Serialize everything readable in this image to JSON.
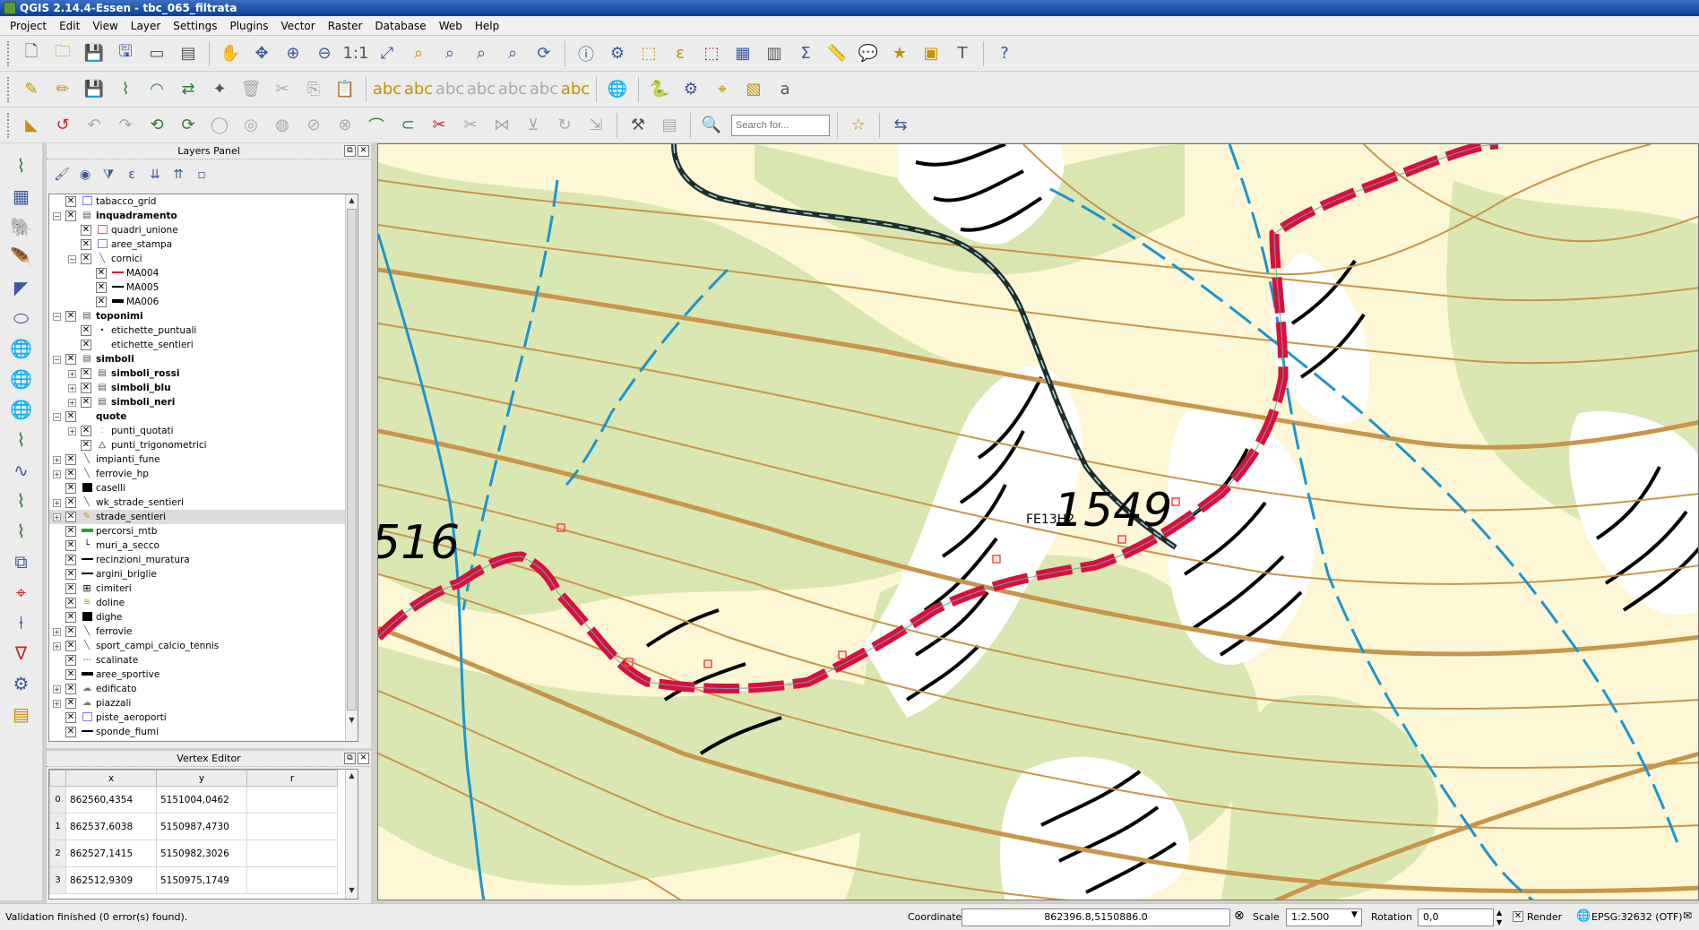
{
  "window": {
    "title": "QGIS 2.14.4-Essen - tbc_065_filtrata"
  },
  "menu": [
    "Project",
    "Edit",
    "View",
    "Layer",
    "Settings",
    "Plugins",
    "Vector",
    "Raster",
    "Database",
    "Web",
    "Help"
  ],
  "toolbar": {
    "search_placeholder": "Search for..."
  },
  "layers_panel": {
    "title": "Layers Panel",
    "layers": [
      {
        "name": "tabacco_grid",
        "depth": 0,
        "expander": "",
        "bold": false,
        "symbol": "square",
        "checked": true
      },
      {
        "name": "inquadramento",
        "depth": 0,
        "expander": "-",
        "bold": true,
        "symbol": "group",
        "checked": true
      },
      {
        "name": "quadri_unione",
        "depth": 1,
        "expander": "",
        "bold": false,
        "symbol": "square-pink",
        "checked": true
      },
      {
        "name": "aree_stampa",
        "depth": 1,
        "expander": "",
        "bold": false,
        "symbol": "square",
        "checked": true
      },
      {
        "name": "cornici",
        "depth": 1,
        "expander": "-",
        "bold": false,
        "symbol": "line-style",
        "checked": true
      },
      {
        "name": "MA004",
        "depth": 2,
        "expander": "",
        "bold": false,
        "symbol": "line-red",
        "checked": true
      },
      {
        "name": "MA005",
        "depth": 2,
        "expander": "",
        "bold": false,
        "symbol": "line-black",
        "checked": true
      },
      {
        "name": "MA006",
        "depth": 2,
        "expander": "",
        "bold": false,
        "symbol": "line-black-thick",
        "checked": true
      },
      {
        "name": "toponimi",
        "depth": 0,
        "expander": "-",
        "bold": true,
        "symbol": "group",
        "checked": true
      },
      {
        "name": "etichette_puntuali",
        "depth": 1,
        "expander": "",
        "bold": false,
        "symbol": "dot",
        "checked": true
      },
      {
        "name": "etichette_sentieri",
        "depth": 1,
        "expander": "",
        "bold": false,
        "symbol": "none",
        "checked": true
      },
      {
        "name": "simboli",
        "depth": 0,
        "expander": "-",
        "bold": true,
        "symbol": "group",
        "checked": true
      },
      {
        "name": "simboli_rossi",
        "depth": 1,
        "expander": "+",
        "bold": true,
        "symbol": "group",
        "checked": true
      },
      {
        "name": "simboli_blu",
        "depth": 1,
        "expander": "+",
        "bold": true,
        "symbol": "group",
        "checked": true
      },
      {
        "name": "simboli_neri",
        "depth": 1,
        "expander": "+",
        "bold": true,
        "symbol": "group",
        "checked": true
      },
      {
        "name": "quote",
        "depth": 0,
        "expander": "-",
        "bold": true,
        "symbol": "none",
        "checked": true
      },
      {
        "name": "punti_quotati",
        "depth": 1,
        "expander": "+",
        "bold": false,
        "symbol": "dots",
        "checked": true
      },
      {
        "name": "punti_trigonometrici",
        "depth": 1,
        "expander": "",
        "bold": false,
        "symbol": "triangle",
        "checked": true
      },
      {
        "name": "impianti_fune",
        "depth": 0,
        "expander": "+",
        "bold": false,
        "symbol": "line-style",
        "checked": true
      },
      {
        "name": "ferrovie_hp",
        "depth": 0,
        "expander": "+",
        "bold": false,
        "symbol": "line-style",
        "checked": true
      },
      {
        "name": "caselli",
        "depth": 0,
        "expander": "",
        "bold": false,
        "symbol": "square-black",
        "checked": true
      },
      {
        "name": "wk_strade_sentieri",
        "depth": 0,
        "expander": "+",
        "bold": false,
        "symbol": "line-style",
        "checked": true
      },
      {
        "name": "strade_sentieri",
        "depth": 0,
        "expander": "+",
        "bold": false,
        "symbol": "line-edit",
        "checked": true,
        "selected": true
      },
      {
        "name": "percorsi_mtb",
        "depth": 0,
        "expander": "",
        "bold": false,
        "symbol": "line-green",
        "checked": true
      },
      {
        "name": "muri_a_secco",
        "depth": 0,
        "expander": "",
        "bold": false,
        "symbol": "corner",
        "checked": true
      },
      {
        "name": "recinzioni_muratura",
        "depth": 0,
        "expander": "",
        "bold": false,
        "symbol": "line-black",
        "checked": true
      },
      {
        "name": "argini_briglie",
        "depth": 0,
        "expander": "",
        "bold": false,
        "symbol": "line-black",
        "checked": true
      },
      {
        "name": "cimiteri",
        "depth": 0,
        "expander": "",
        "bold": false,
        "symbol": "cross-box",
        "checked": true
      },
      {
        "name": "doline",
        "depth": 0,
        "expander": "",
        "bold": false,
        "symbol": "doline",
        "checked": true
      },
      {
        "name": "dighe",
        "depth": 0,
        "expander": "",
        "bold": false,
        "symbol": "square-black",
        "checked": true
      },
      {
        "name": "ferrovie",
        "depth": 0,
        "expander": "+",
        "bold": false,
        "symbol": "line-style",
        "checked": true
      },
      {
        "name": "sport_campi_calcio_tennis",
        "depth": 0,
        "expander": "+",
        "bold": false,
        "symbol": "line-style",
        "checked": true
      },
      {
        "name": "scalinate",
        "depth": 0,
        "expander": "",
        "bold": false,
        "symbol": "dotted",
        "checked": true
      },
      {
        "name": "aree_sportive",
        "depth": 0,
        "expander": "",
        "bold": false,
        "symbol": "line-black-thick",
        "checked": true
      },
      {
        "name": "edificato",
        "depth": 0,
        "expander": "+",
        "bold": false,
        "symbol": "cloud",
        "checked": true
      },
      {
        "name": "piazzali",
        "depth": 0,
        "expander": "+",
        "bold": false,
        "symbol": "cloud",
        "checked": true
      },
      {
        "name": "piste_aeroporti",
        "depth": 0,
        "expander": "",
        "bold": false,
        "symbol": "square",
        "checked": true
      },
      {
        "name": "sponde_fiumi",
        "depth": 0,
        "expander": "",
        "bold": false,
        "symbol": "line-black",
        "checked": true
      }
    ]
  },
  "vertex_editor": {
    "title": "Vertex Editor",
    "columns": [
      "x",
      "y",
      "r"
    ],
    "rows": [
      {
        "index": "0",
        "x": "862560,4354",
        "y": "5151004,0462",
        "r": ""
      },
      {
        "index": "1",
        "x": "862537,6038",
        "y": "5150987,4730",
        "r": ""
      },
      {
        "index": "2",
        "x": "862527,1415",
        "y": "5150982,3026",
        "r": ""
      },
      {
        "index": "3",
        "x": "862512,9309",
        "y": "5150975,1749",
        "r": ""
      }
    ]
  },
  "map": {
    "labels": {
      "elev_left": "516",
      "elev_right": "1549",
      "sheet_code": "FE13H2"
    },
    "colors": {
      "background": "#fdf7d6",
      "forest": "#d9e6b0",
      "contour": "#c8954a",
      "river": "#1a95cf",
      "trail": "#d90f3e",
      "road": "#1f2d2d"
    }
  },
  "statusbar": {
    "message": "Validation finished (0 error(s) found).",
    "coordinate_label": "Coordinate",
    "coordinate": "862396.8,5150886.0",
    "scale_label": "Scale",
    "scale": "1:2.500",
    "rotation_label": "Rotation",
    "rotation": "0,0",
    "render_label": "Render",
    "crs": "EPSG:32632 (OTF)"
  }
}
